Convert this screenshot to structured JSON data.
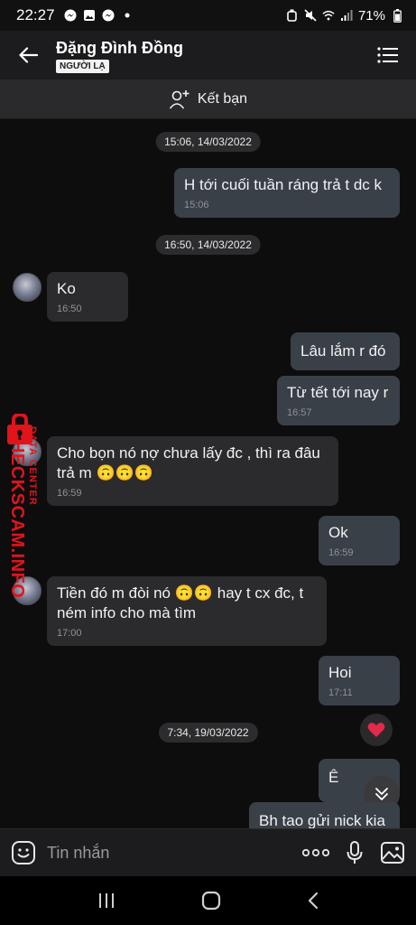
{
  "status_bar": {
    "time": "22:27",
    "battery": "71%"
  },
  "header": {
    "contact_name": "Đặng Đình Đồng",
    "badge": "NGƯỜI LẠ"
  },
  "add_friend": {
    "label": "Kết bạn"
  },
  "messages": [
    {
      "type": "date",
      "text": "15:06, 14/03/2022"
    },
    {
      "type": "out",
      "text": "H tới cuối tuần ráng trả t dc k",
      "time": "15:06"
    },
    {
      "type": "date",
      "text": "16:50, 14/03/2022"
    },
    {
      "type": "in",
      "text": "Ko",
      "time": "16:50"
    },
    {
      "type": "out",
      "text": "Lâu lắm r đó",
      "time": ""
    },
    {
      "type": "out",
      "text": "Từ tết tới nay r",
      "time": "16:57"
    },
    {
      "type": "in",
      "text_line1": "Cho bọn nó nợ chưa lấy đc , thì ra đâu",
      "text_line2": "trả m 🙃🙃🙃",
      "time": "16:59"
    },
    {
      "type": "out",
      "text": "Ok",
      "time": "16:59"
    },
    {
      "type": "in",
      "text_line1": "Tiền đó m đòi nó 🙃🙃 hay t cx đc, t",
      "text_line2": "ném info cho mà tìm",
      "time": "17:00"
    },
    {
      "type": "out",
      "text": "Hoi",
      "time": "17:11"
    },
    {
      "type": "date",
      "text": "7:34, 19/03/2022"
    },
    {
      "type": "out",
      "text": "Ê",
      "time": ""
    },
    {
      "type": "out",
      "text": "Bh tao gửi nick kia",
      "time": ""
    }
  ],
  "watermark": {
    "line1": "DATA CENTER",
    "line2": "CHECKSCAM.INFO"
  },
  "input": {
    "placeholder": "Tin nhắn"
  },
  "colors": {
    "incoming_bubble": "#2b2b2d",
    "outgoing_bubble": "#3a4048",
    "reaction_heart": "#e5294a"
  },
  "icons": [
    "back-arrow-icon",
    "list-menu-icon",
    "add-user-icon",
    "heart-icon",
    "chevron-down-icon",
    "emoji-icon",
    "more-dots-icon",
    "microphone-icon",
    "image-icon",
    "nav-recent-icon",
    "nav-home-icon",
    "nav-back-icon"
  ]
}
